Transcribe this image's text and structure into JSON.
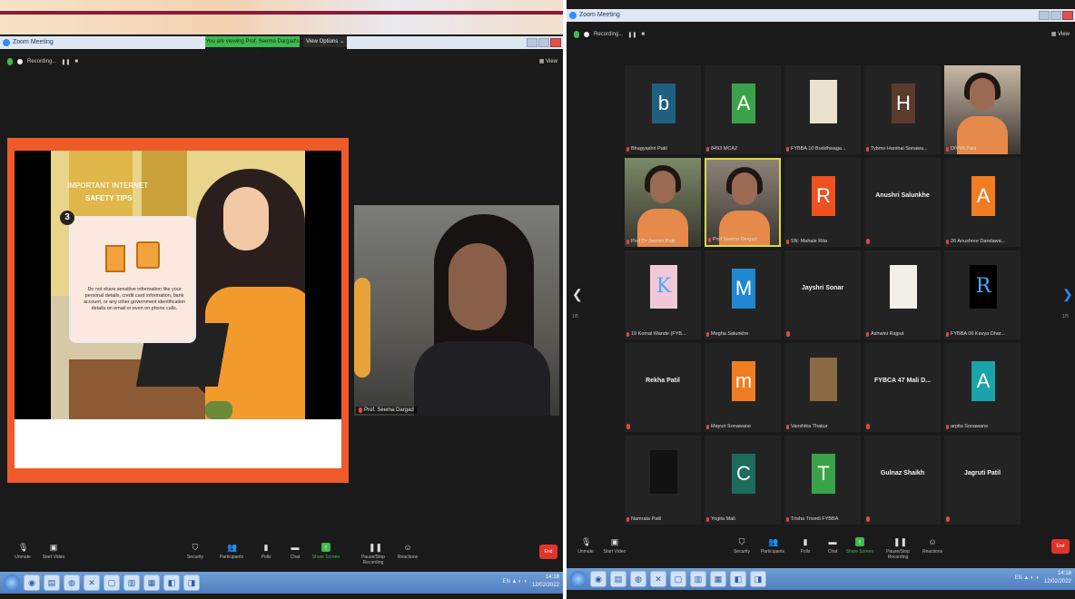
{
  "left": {
    "window_title": "Zoom Meeting",
    "viewing_banner": "You are viewing Prof. Seema Dargad's screen",
    "view_options": "View Options ⌄",
    "recording": "Recording...",
    "view_label": "View",
    "slide": {
      "title_line1": "IMPORTANT INTERNET",
      "title_line2": "SAFETY TIPS",
      "number": "3",
      "text": "Do not share sensitive information like your personal details, credit card information, bank account, or any other government identification details on email or even on phone calls."
    },
    "presenter_name": "Prof. Seema Dargad"
  },
  "right": {
    "window_title": "Zoom Meeting",
    "recording": "Recording...",
    "view_label": "View",
    "page_left": "1/5",
    "page_right": "1/5",
    "tiles": [
      {
        "name": "Bhagyashri Patil",
        "avatar": "b",
        "color": "#1f5f80",
        "kind": "letter"
      },
      {
        "name": "8493 MCA2",
        "avatar": "A",
        "color": "#3aa34a",
        "kind": "letter"
      },
      {
        "name": "FYBBA 10 Buddhisaga...",
        "avatar": "",
        "color": "#eae1cf",
        "kind": "image"
      },
      {
        "name": "Tybms Harshal Sonawa...",
        "avatar": "H",
        "color": "#5a3b2c",
        "kind": "letter"
      },
      {
        "name": "DIVYA Patil",
        "avatar": "",
        "color": "#c9b9a6",
        "kind": "photo"
      },
      {
        "name": "Prof Dr Jasmin Patil",
        "avatar": "",
        "color": "#7a8a66",
        "kind": "photo"
      },
      {
        "name": "Prof Seema Dargad",
        "avatar": "",
        "color": "#8c8278",
        "kind": "photo"
      },
      {
        "name": "SN: Mahale Rita",
        "avatar": "R",
        "color": "#ef5121",
        "kind": "letter"
      },
      {
        "name": "Anushri Salunkhe",
        "avatar": "",
        "color": "",
        "kind": "name"
      },
      {
        "name": "26 Anushree Dandawa...",
        "avatar": "A",
        "color": "#f07d21",
        "kind": "letter"
      },
      {
        "name": "19 Komal Wande (FYB...",
        "avatar": "K",
        "color": "#f1c9d6",
        "kind": "image"
      },
      {
        "name": "Megha Salunkhe",
        "avatar": "M",
        "color": "#1f88d0",
        "kind": "letter"
      },
      {
        "name": "Jayshri Sonar",
        "avatar": "",
        "color": "",
        "kind": "name"
      },
      {
        "name": "Ashwini Rajput",
        "avatar": "",
        "color": "#f1efe8",
        "kind": "image"
      },
      {
        "name": "FYBBA 06 Kavya Dhar...",
        "avatar": "R",
        "color": "#000000",
        "kind": "image"
      },
      {
        "name": "Rekha Patil",
        "avatar": "",
        "color": "",
        "kind": "name"
      },
      {
        "name": "Mayuri Sonawane",
        "avatar": "m",
        "color": "#f07d21",
        "kind": "letter"
      },
      {
        "name": "Vanshika Thakur",
        "avatar": "",
        "color": "#8a6a44",
        "kind": "image"
      },
      {
        "name": "FYBCA 47 Mali D...",
        "avatar": "",
        "color": "",
        "kind": "name"
      },
      {
        "name": "arpita Sonawane",
        "avatar": "A",
        "color": "#1aa3a8",
        "kind": "letter"
      },
      {
        "name": "Namrata Patil",
        "avatar": "",
        "color": "#111111",
        "kind": "image"
      },
      {
        "name": "Yogita Mali",
        "avatar": "C",
        "color": "#1d6b5a",
        "kind": "letter"
      },
      {
        "name": "Trisha Trivedi FYBBA",
        "avatar": "T",
        "color": "#3aa34a",
        "kind": "letter"
      },
      {
        "name": "Gulnaz Shaikh",
        "avatar": "",
        "color": "",
        "kind": "name"
      },
      {
        "name": "Jagruti Patil",
        "avatar": "",
        "color": "",
        "kind": "name"
      }
    ]
  },
  "toolbar": {
    "unmute": "Unmute",
    "start_video": "Start Video",
    "security": "Security",
    "participants": "Participants",
    "participants_count_left": "29",
    "participants_count_right": "123",
    "polls": "Polls",
    "chat": "Chat",
    "share_screen": "Share Screen",
    "pause_recording": "Pause/Stop Recording",
    "reactions": "Reactions",
    "end": "End"
  },
  "taskbar": {
    "clock_time": "14:18",
    "clock_date": "12/02/2022",
    "lang": "EN"
  }
}
